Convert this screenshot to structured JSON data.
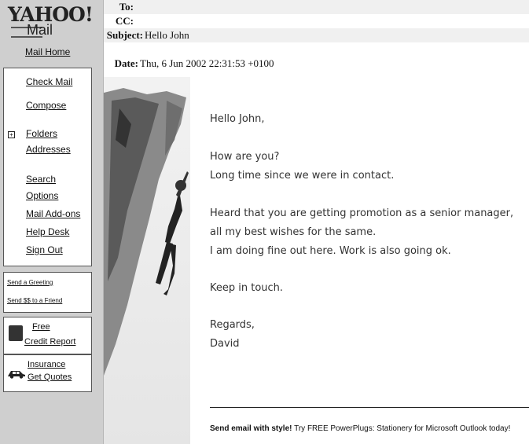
{
  "sidebar": {
    "logo": {
      "yahoo": "YAHOO!",
      "mail": "Mail",
      "home": "Mail Home"
    },
    "nav": [
      "Check Mail",
      "Compose",
      "Folders",
      "Addresses",
      "Search",
      "Options",
      "Mail Add-ons",
      "Help Desk",
      "Sign Out"
    ],
    "greetings": [
      "Send a Greeting",
      "Send $$ to a Friend"
    ],
    "credit": {
      "free": "Free",
      "label": "Credit Report"
    },
    "insurance": {
      "label": "Insurance",
      "quotes": "Get Quotes"
    }
  },
  "header": {
    "to_label": "To:",
    "to_value": "",
    "cc_label": "CC:",
    "cc_value": "",
    "subject_label": "Subject:",
    "subject_value": "Hello John",
    "date_label": "Date:",
    "date_value": "Thu, 6 Jun 2002 22:31:53 +0100"
  },
  "message": {
    "lines": [
      "Hello John,",
      "How are you?",
      "Long time since we were in contact.",
      "Heard that you are getting promotion as a senior manager,",
      "all my best wishes for the same.",
      "I am doing fine out here. Work is also going ok.",
      "Keep in touch.",
      "Regards,",
      "David"
    ]
  },
  "promo": {
    "bold": "Send email with style!",
    "link": "Try FREE PowerPlugs: Stationery",
    "rest": "for Microsoft Outlook today!"
  }
}
